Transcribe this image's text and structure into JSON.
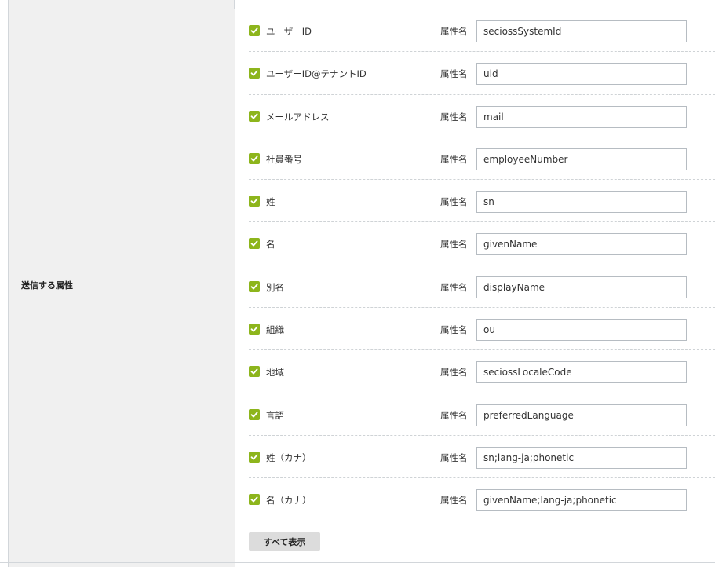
{
  "section": {
    "label": "送信する属性",
    "property_label": "属性名",
    "show_all_label": "すべて表示"
  },
  "attributes": [
    {
      "name": "ユーザーID",
      "checked": true,
      "value": "seciossSystemId"
    },
    {
      "name": "ユーザーID@テナントID",
      "checked": true,
      "value": "uid"
    },
    {
      "name": "メールアドレス",
      "checked": true,
      "value": "mail"
    },
    {
      "name": "社員番号",
      "checked": true,
      "value": "employeeNumber"
    },
    {
      "name": "姓",
      "checked": true,
      "value": "sn"
    },
    {
      "name": "名",
      "checked": true,
      "value": "givenName"
    },
    {
      "name": "別名",
      "checked": true,
      "value": "displayName"
    },
    {
      "name": "組織",
      "checked": true,
      "value": "ou"
    },
    {
      "name": "地域",
      "checked": true,
      "value": "seciossLocaleCode"
    },
    {
      "name": "言語",
      "checked": true,
      "value": "preferredLanguage"
    },
    {
      "name": "姓（カナ）",
      "checked": true,
      "value": "sn;lang-ja;phonetic"
    },
    {
      "name": "名（カナ）",
      "checked": true,
      "value": "givenName;lang-ja;phonetic"
    }
  ],
  "colors": {
    "checkbox": "#8db51c",
    "label_bg": "#f0f0f0",
    "border": "#d2d6da"
  }
}
